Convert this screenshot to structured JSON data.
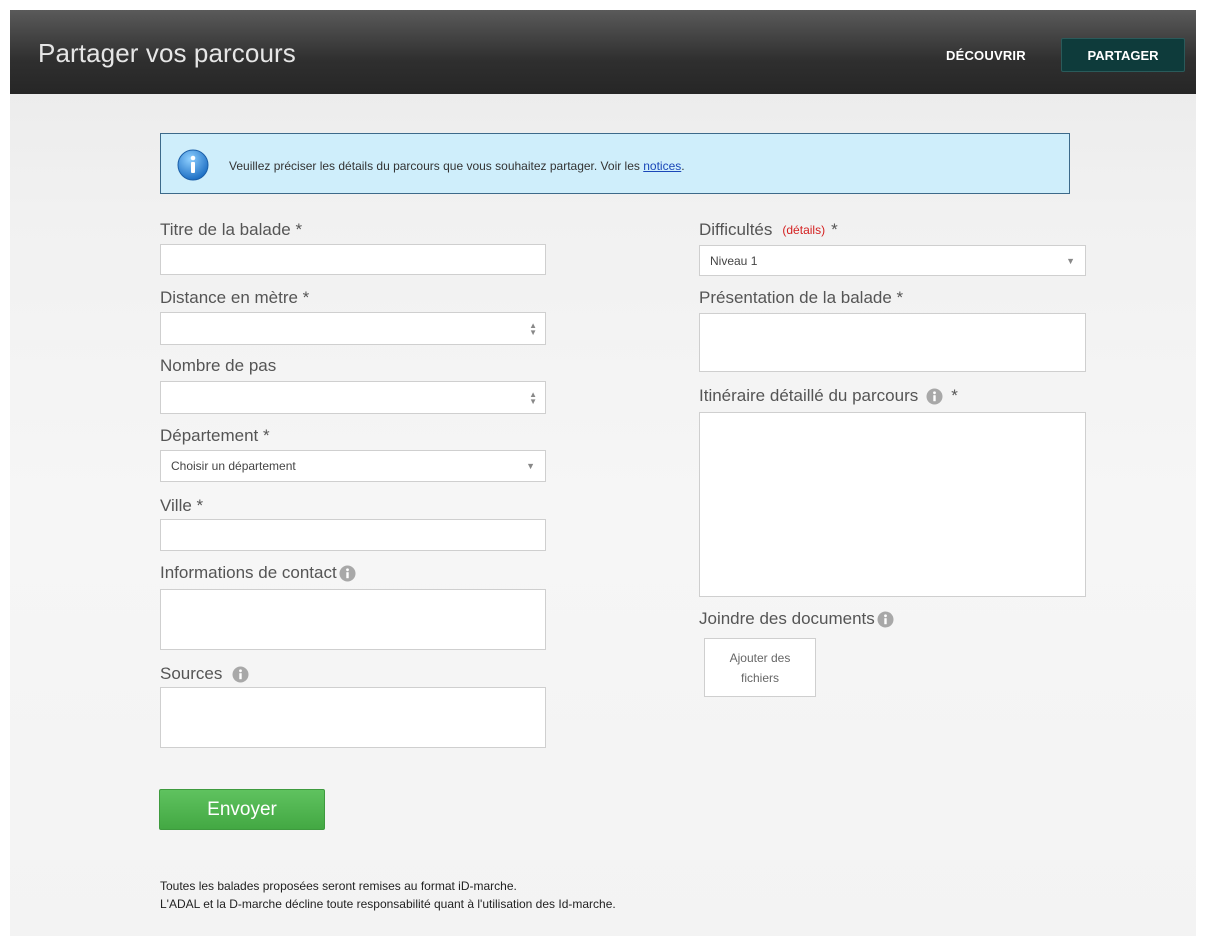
{
  "header": {
    "title": "Partager vos parcours",
    "nav": {
      "discover": "DÉCOUVRIR",
      "share": "PARTAGER"
    }
  },
  "alert": {
    "text": "Veuillez préciser les détails du parcours que vous souhaitez partager. Voir les ",
    "link": "notices",
    "suffix": ".",
    "icon": "info-icon"
  },
  "form": {
    "title_label": "Titre de la balade *",
    "distance_label": "Distance en mètre *",
    "steps_label": "Nombre de pas",
    "department_label": "Département *",
    "department_value": "Choisir un département",
    "city_label": "Ville *",
    "contact_label": "Informations de contact",
    "sources_label": "Sources",
    "difficulty_label": "Difficultés",
    "difficulty_details_link": "(détails)",
    "difficulty_required": "*",
    "difficulty_value": "Niveau 1",
    "presentation_label": "Présentation de la balade *",
    "itinerary_label": "Itinéraire détaillé du parcours",
    "itinerary_required": "*",
    "attachments_label": "Joindre des documents",
    "upload_button": "Ajouter des fichiers",
    "submit_button": "Envoyer"
  },
  "footer": {
    "line1": "Toutes les balades proposées seront remises au format iD-marche.",
    "line2": "L'ADAL et la D-marche décline toute responsabilité quant à l'utilisation des Id-marche."
  },
  "colors": {
    "header_bg": "#2f2f2f",
    "share_button_bg": "#0e3b3b",
    "alert_bg": "#cfeefb",
    "alert_border": "#3d6a8a",
    "submit_bg": "#4cb34c",
    "details_link": "#d42020"
  }
}
